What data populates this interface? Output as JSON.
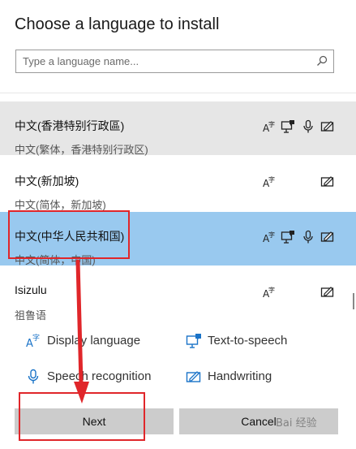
{
  "dialog": {
    "title": "Choose a language to install"
  },
  "search": {
    "placeholder": "Type a language name..."
  },
  "languages": [
    {
      "name": "中文(香港特别行政區)",
      "native": "中文(繁体，香港特别行政区)",
      "features": [
        "display",
        "tts",
        "speech",
        "handwriting"
      ],
      "state": "hovered"
    },
    {
      "name": "中文(新加坡)",
      "native": "中文(简体，新加坡)",
      "features": [
        "display",
        "handwriting"
      ],
      "state": "normal"
    },
    {
      "name": "中文(中华人民共和国)",
      "native": "中文(简体，中国)",
      "features": [
        "display",
        "tts",
        "speech",
        "handwriting"
      ],
      "state": "selected"
    },
    {
      "name": "Isizulu",
      "native": "祖鲁语",
      "features": [
        "display",
        "handwriting"
      ],
      "state": "normal"
    }
  ],
  "legend": {
    "display": "Display language",
    "tts": "Text-to-speech",
    "speech": "Speech recognition",
    "handwriting": "Handwriting"
  },
  "buttons": {
    "next": "Next",
    "cancel": "Cancel"
  },
  "watermark": "Bai 经验",
  "colors": {
    "selected_row": "#99c9ef",
    "hovered_row": "#e6e6e6",
    "accent_icon": "#1a73c8",
    "annotation_red": "#e0262a",
    "button_bg": "#cccccc"
  }
}
